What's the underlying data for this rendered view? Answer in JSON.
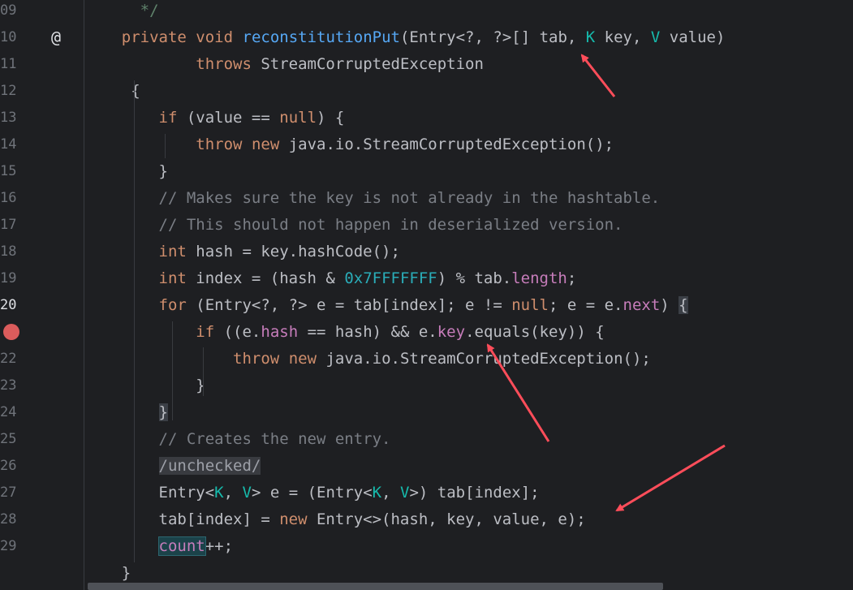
{
  "editor": {
    "line_numbers": [
      "09",
      "10",
      "11",
      "12",
      "13",
      "14",
      "15",
      "16",
      "17",
      "18",
      "19",
      "20",
      "21",
      "22",
      "23",
      "24",
      "25",
      "26",
      "27",
      "28",
      "29"
    ],
    "current_line": "20",
    "breakpoint_line": "21",
    "annotation_icon_glyph": "@",
    "lines": [
      [
        {
          "t": "      */",
          "c": "jd"
        }
      ],
      [
        {
          "t": "    "
        },
        {
          "t": "private",
          "c": "kw"
        },
        {
          "t": " "
        },
        {
          "t": "void",
          "c": "kw"
        },
        {
          "t": " "
        },
        {
          "t": "reconstitutionPut",
          "c": "fn"
        },
        {
          "t": "(Entry<?, ?>[] tab, "
        },
        {
          "t": "K",
          "c": "tp"
        },
        {
          "t": " key, "
        },
        {
          "t": "V",
          "c": "tp"
        },
        {
          "t": " value)"
        }
      ],
      [
        {
          "t": "            "
        },
        {
          "t": "throws",
          "c": "kw"
        },
        {
          "t": " StreamCorruptedException"
        }
      ],
      [
        {
          "t": "     {"
        }
      ],
      [
        {
          "t": "        "
        },
        {
          "t": "if",
          "c": "kw"
        },
        {
          "t": " (value == "
        },
        {
          "t": "null",
          "c": "kw"
        },
        {
          "t": ") {"
        }
      ],
      [
        {
          "t": "            "
        },
        {
          "t": "throw",
          "c": "kw"
        },
        {
          "t": " "
        },
        {
          "t": "new",
          "c": "kw"
        },
        {
          "t": " java.io.StreamCorruptedException();"
        }
      ],
      [
        {
          "t": "        }"
        }
      ],
      [
        {
          "t": "        "
        },
        {
          "t": "// Makes sure the key is not already in the hashtable.",
          "c": "cm"
        }
      ],
      [
        {
          "t": "        "
        },
        {
          "t": "// This should not happen in deserialized version.",
          "c": "cm"
        }
      ],
      [
        {
          "t": "        "
        },
        {
          "t": "int",
          "c": "kw"
        },
        {
          "t": " hash = key.hashCode();"
        }
      ],
      [
        {
          "t": "        "
        },
        {
          "t": "int",
          "c": "kw"
        },
        {
          "t": " index = (hash & "
        },
        {
          "t": "0x7FFFFFFF",
          "c": "num"
        },
        {
          "t": ") % tab."
        },
        {
          "t": "length",
          "c": "fld"
        },
        {
          "t": ";"
        }
      ],
      [
        {
          "t": "        "
        },
        {
          "t": "for",
          "c": "kw"
        },
        {
          "t": " (Entry<?, ?> e = tab[index]; e != "
        },
        {
          "t": "null",
          "c": "kw"
        },
        {
          "t": "; e = e."
        },
        {
          "t": "next",
          "c": "fld"
        },
        {
          "t": ") "
        },
        {
          "t": "{",
          "c": "brace-hl"
        }
      ],
      [
        {
          "t": "            "
        },
        {
          "t": "if",
          "c": "kw"
        },
        {
          "t": " ((e."
        },
        {
          "t": "hash",
          "c": "fld"
        },
        {
          "t": " == hash) && e."
        },
        {
          "t": "key",
          "c": "fld"
        },
        {
          "t": ".equals(key)) {"
        }
      ],
      [
        {
          "t": "                "
        },
        {
          "t": "throw",
          "c": "kw"
        },
        {
          "t": " "
        },
        {
          "t": "new",
          "c": "kw"
        },
        {
          "t": " java.io.StreamCorruptedException();"
        }
      ],
      [
        {
          "t": "            }"
        }
      ],
      [
        {
          "t": "        "
        },
        {
          "t": "}",
          "c": "brace-hl"
        }
      ],
      [
        {
          "t": "        "
        },
        {
          "t": "// Creates the new entry.",
          "c": "cm"
        }
      ],
      [
        {
          "t": "        "
        },
        {
          "t": "/unchecked/",
          "c": "inlay"
        }
      ],
      [
        {
          "t": "        Entry<"
        },
        {
          "t": "K",
          "c": "tp"
        },
        {
          "t": ", "
        },
        {
          "t": "V",
          "c": "tp"
        },
        {
          "t": "> e = (Entry<"
        },
        {
          "t": "K",
          "c": "tp"
        },
        {
          "t": ", "
        },
        {
          "t": "V",
          "c": "tp"
        },
        {
          "t": ">) tab[index];"
        }
      ],
      [
        {
          "t": "        tab[index] = "
        },
        {
          "t": "new",
          "c": "kw"
        },
        {
          "t": " Entry<>(hash, key, value, e);"
        }
      ],
      [
        {
          "t": "        "
        },
        {
          "t": "count",
          "c": "ref"
        },
        {
          "t": "++;"
        }
      ],
      [
        {
          "t": "    }"
        }
      ]
    ]
  },
  "colors": {
    "background": "#1e1f22",
    "keyword": "#cf8e6d",
    "function": "#56a8f5",
    "type_param": "#16baac",
    "comment": "#7a7e85",
    "number": "#2aacb8",
    "field": "#c77dbb",
    "breakpoint": "#db5c5c",
    "annotation_arrow": "#ff4d5a"
  }
}
